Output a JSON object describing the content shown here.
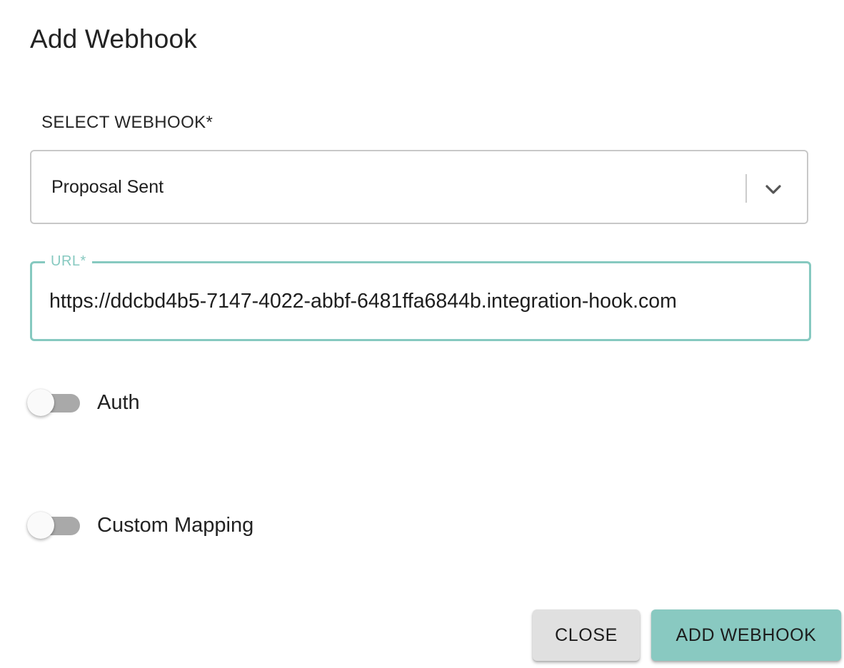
{
  "dialog": {
    "title": "Add Webhook"
  },
  "select_webhook": {
    "label": "SELECT WEBHOOK*",
    "value": "Proposal Sent",
    "icon": "chevron-down-icon"
  },
  "url_field": {
    "label": "URL*",
    "value": "https://ddcbd4b5-7147-4022-abbf-6481ffa6844b.integration-hook.com"
  },
  "toggles": {
    "auth": {
      "label": "Auth",
      "checked": false
    },
    "custom_mapping": {
      "label": "Custom Mapping",
      "checked": false
    }
  },
  "actions": {
    "close_label": "CLOSE",
    "add_label": "ADD WEBHOOK"
  },
  "colors": {
    "accent": "#86c9c0",
    "primary_button": "#89c9c1",
    "secondary_button": "#e0e0e0",
    "toggle_off_track": "#a9a9a9"
  }
}
